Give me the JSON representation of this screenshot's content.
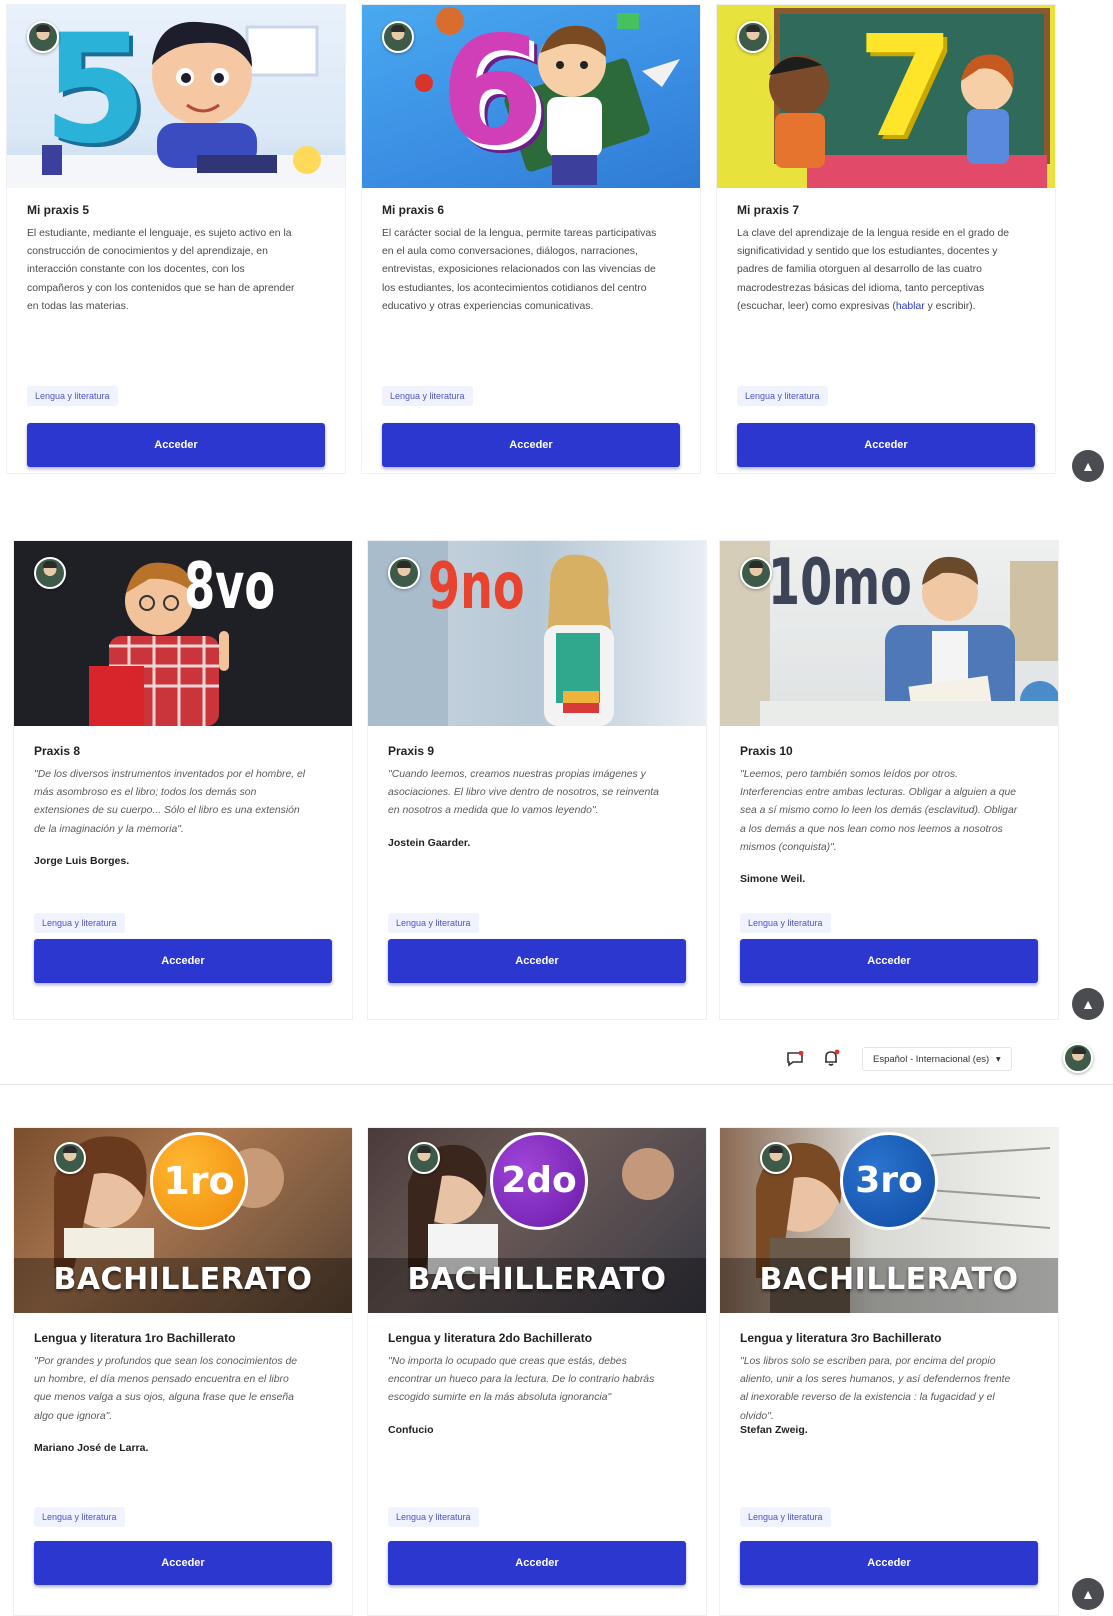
{
  "common": {
    "tag_label": "Lengua y literatura",
    "button_label": "Acceder",
    "scroll_top_icon": "chevron-up-icon"
  },
  "header": {
    "language_select": "Español - Internacional (es)",
    "messages_icon": "chat-icon",
    "notifications_icon": "bell-icon"
  },
  "cards": [
    {
      "title": "Mi praxis 5",
      "image_text": "5",
      "description": "El estudiante, mediante el lenguaje, es sujeto activo en la construcción de conocimientos y del aprendizaje, en interacción constante con los docentes, con los compañeros y con los contenidos que se han de aprender en todas las materias."
    },
    {
      "title": "Mi praxis 6",
      "image_text": "6",
      "description": "El carácter social de la lengua, permite tareas participativas en el aula como conversaciones, diálogos, narraciones, entrevistas, exposiciones relacionados con las vivencias de los estudiantes, los acontecimientos cotidianos del centro educativo y otras experiencias comunicativas."
    },
    {
      "title": "Mi praxis 7",
      "image_text": "7",
      "description": "La clave del aprendizaje de la lengua reside en el grado de significatividad y sentido que los estudiantes, docentes y padres de familia otorguen al desarrollo de las cuatro macrodestrezas básicas del idioma, tanto perceptivas (escuchar, leer) como expresivas (",
      "description_link": "hablar",
      "description_end": " y escribir)."
    },
    {
      "title": "Praxis 8",
      "image_text": "8vo",
      "description": "\"De los diversos instrumentos inventados por el hombre, el más asombroso es el libro; todos los demás son extensiones de su cuerpo... Sólo el libro es una extensión de la imaginación y la memoria\".",
      "author": "Jorge Luis Borges."
    },
    {
      "title": "Praxis 9",
      "image_text": "9no",
      "description": "\"Cuando leemos, creamos nuestras propias imágenes y asociaciones. El libro vive dentro de nosotros, se reinventa en nosotros a medida que lo vamos leyendo\".",
      "author": "Jostein Gaarder."
    },
    {
      "title": "Praxis 10",
      "image_text": "10mo",
      "description": "\"Leemos, pero también somos leídos por otros. Interferencias entre ambas lecturas. Obligar a alguien a que sea a sí mismo como lo leen los demás (esclavitud). Obligar a los demás a que nos lean como nos leemos a nosotros mismos (conquista)\".",
      "author": "Simone Weil."
    },
    {
      "title": "Lengua y literatura 1ro Bachillerato",
      "image_text": "1ro",
      "image_banner": "BACHILLERATO",
      "description": "\"Por grandes y profundos que sean los conocimientos de un hombre, el día menos pensado encuentra en el libro que menos valga a sus ojos, alguna frase que le enseña algo que ignora\".",
      "author": "Mariano José de Larra."
    },
    {
      "title": "Lengua y literatura 2do Bachillerato",
      "image_text": "2do",
      "image_banner": "BACHILLERATO",
      "description": "\"No importa lo ocupado que creas que estás, debes encontrar un hueco para la lectura. De lo contrario habrás escogido sumirte en la más absoluta ignorancia\"",
      "author": "Confucio"
    },
    {
      "title": "Lengua y literatura 3ro Bachillerato",
      "image_text": "3ro",
      "image_banner": "BACHILLERATO",
      "description": "\"Los libros solo se escriben para, por encima del propio aliento, unir a los seres humanos, y así defendernos frente al inexorable reverso de la existencia : la fugacidad y el olvido\".",
      "author": "Stefan Zweig."
    }
  ]
}
